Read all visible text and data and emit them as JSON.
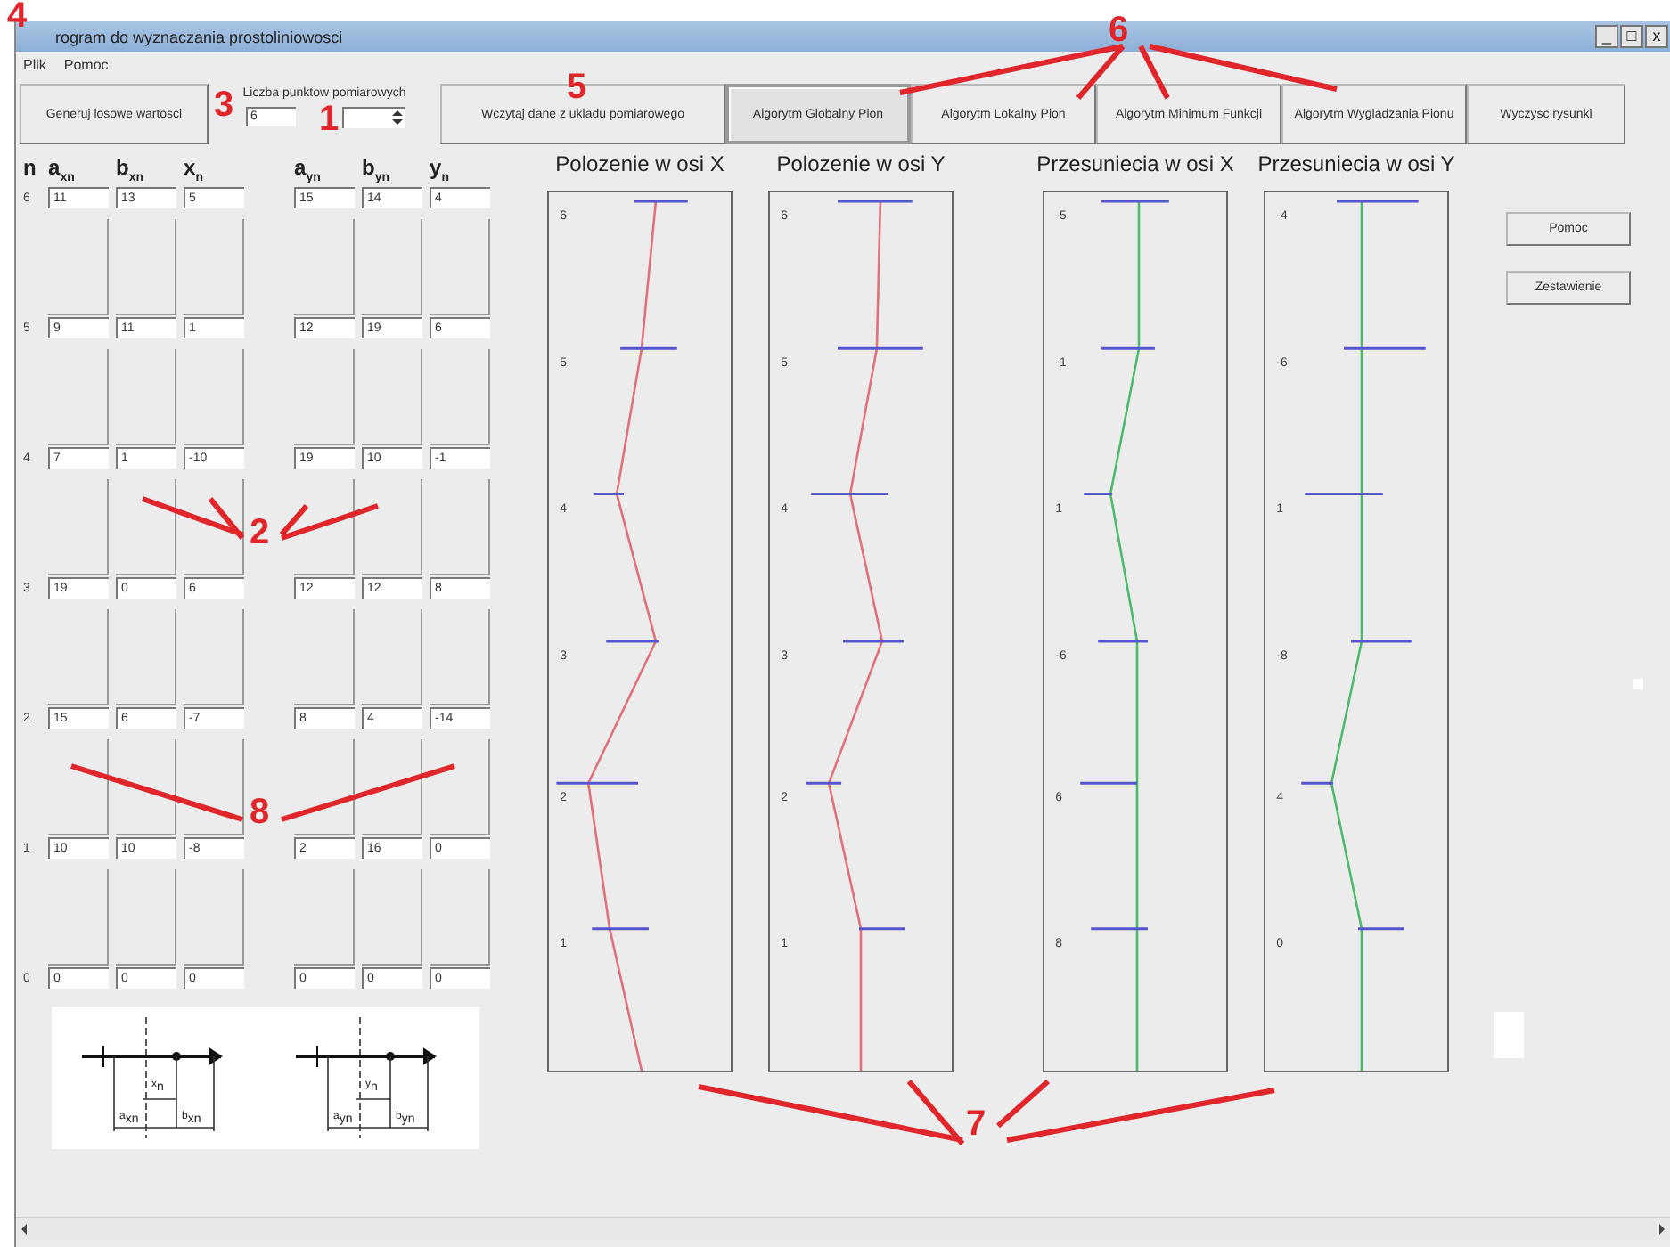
{
  "window": {
    "title": "rogram do wyznaczania prostoliniowosci",
    "controls": [
      "_",
      "□",
      "x"
    ]
  },
  "menu": [
    {
      "label": "Plik"
    },
    {
      "label": "Pomoc"
    }
  ],
  "toolbar": {
    "generate_button": "Generuj losowe wartosci",
    "points_label": "Liczba punktow pomiarowych",
    "points_value": "6",
    "load_button": "Wczytaj dane z ukladu pomiarowego"
  },
  "algorithm_buttons": [
    {
      "label": "Algorytm Globalny Pion",
      "selected": true
    },
    {
      "label": "Algorytm Lokalny Pion",
      "selected": false
    },
    {
      "label": "Algorytm Minimum Funkcji",
      "selected": false
    },
    {
      "label": "Algorytm Wygladzania Pionu",
      "selected": false
    },
    {
      "label": "Wyczysc rysunki",
      "selected": false
    }
  ],
  "table": {
    "columns": [
      "n",
      "a$_{xn}$",
      "b$_{xn}$",
      "x$_{n}$",
      "a$_{yn}$",
      "b$_{yn}$",
      "y$_{n}$"
    ],
    "rows": [
      {
        "n": "6",
        "values": [
          "11",
          "13",
          "5",
          "15",
          "14",
          "4"
        ]
      },
      {
        "n": "5",
        "values": [
          "9",
          "11",
          "1",
          "12",
          "19",
          "6"
        ]
      },
      {
        "n": "4",
        "values": [
          "7",
          "1",
          "-10",
          "19",
          "10",
          "-1"
        ]
      },
      {
        "n": "3",
        "values": [
          "19",
          "0",
          "6",
          "12",
          "12",
          "8"
        ]
      },
      {
        "n": "2",
        "values": [
          "15",
          "6",
          "-7",
          "8",
          "4",
          "-14"
        ]
      },
      {
        "n": "1",
        "values": [
          "10",
          "10",
          "-8",
          "2",
          "16",
          "0"
        ]
      },
      {
        "n": "0",
        "values": [
          "0",
          "0",
          "0",
          "0",
          "0",
          "0"
        ]
      }
    ]
  },
  "diagrams": [
    {
      "labels": [
        "x$_{n}$",
        "a$_{xn}$",
        "b$_{xn}$"
      ]
    },
    {
      "labels": [
        "y$_{n}$",
        "a$_{yn}$",
        "b$_{yn}$"
      ]
    }
  ],
  "plots": [
    {
      "title": "Polozenie w osi X",
      "kind": "position",
      "labels": [
        "6",
        "5",
        "4",
        "3",
        "2",
        "1"
      ]
    },
    {
      "title": "Polozenie w osi Y",
      "kind": "position",
      "labels": [
        "6",
        "5",
        "4",
        "3",
        "2",
        "1"
      ]
    },
    {
      "title": "Przesuniecia w osi X",
      "kind": "shift",
      "labels": [
        "-5",
        "-1",
        "1",
        "-6",
        "6",
        "8"
      ]
    },
    {
      "title": "Przesuniecia w osi Y",
      "kind": "shift",
      "labels": [
        "-4",
        "-6",
        "1",
        "-8",
        "4",
        "0"
      ]
    }
  ],
  "side_buttons": [
    "Pomoc",
    "Zestawienie"
  ],
  "callouts": [
    "4",
    "3",
    "1",
    "5",
    "6",
    "2",
    "8",
    "7"
  ]
}
